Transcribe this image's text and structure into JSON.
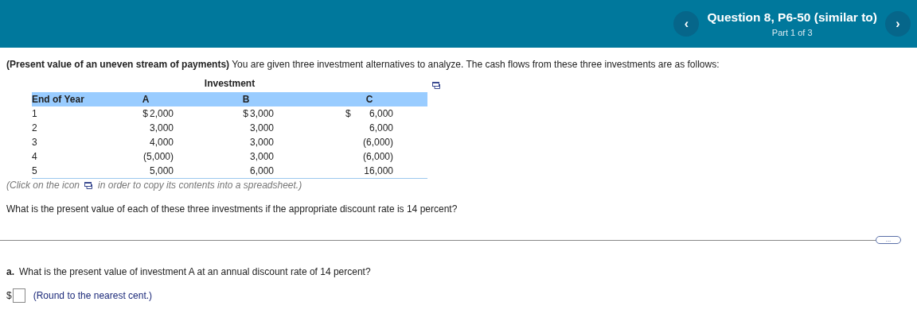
{
  "header": {
    "title": "Question 8, P6-50 (similar to)",
    "subtitle": "Part 1 of 3",
    "prev": "‹",
    "next": "›"
  },
  "intro": "**(Present value of an uneven stream of payments)** You are given three investment alternatives to analyze.  The cash flows from these three investments are as follows:",
  "table": {
    "caption": "Investment",
    "columns": [
      "End of Year",
      "A",
      "B",
      "C"
    ],
    "rows": [
      {
        "year": "1",
        "cells": [
          {
            "currency": "$",
            "amount": "2,000"
          },
          {
            "currency": "$",
            "amount": "3,000"
          },
          {
            "currency": "$",
            "amount": "6,000"
          }
        ]
      },
      {
        "year": "2",
        "cells": [
          {
            "amount": "3,000"
          },
          {
            "amount": "3,000"
          },
          {
            "amount": "6,000"
          }
        ]
      },
      {
        "year": "3",
        "cells": [
          {
            "amount": "4,000"
          },
          {
            "amount": "3,000"
          },
          {
            "amount": "(6,000)"
          }
        ]
      },
      {
        "year": "4",
        "cells": [
          {
            "amount": "(5,000)"
          },
          {
            "amount": "3,000"
          },
          {
            "amount": "(6,000)"
          }
        ]
      },
      {
        "year": "5",
        "cells": [
          {
            "amount": "5,000"
          },
          {
            "amount": "6,000"
          },
          {
            "amount": "16,000"
          }
        ]
      }
    ]
  },
  "copy_note": {
    "before": "(Click on the icon",
    "after": "in order to copy its contents into a spreadsheet.)"
  },
  "question": "What is the present value of each of these three investments if the appropriate discount rate is 14 percent?",
  "more_button": "...",
  "part": {
    "label": "a.",
    "text": "What is the present value of investment A at an annual discount rate of 14 percent?",
    "currency": "$",
    "hint": "(Round to the nearest cent.)"
  }
}
